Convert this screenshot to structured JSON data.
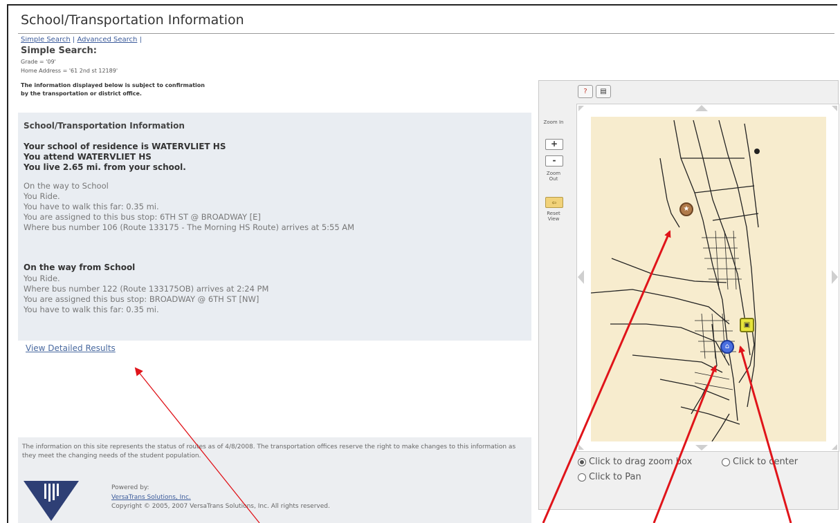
{
  "page": {
    "title": "School/Transportation Information",
    "breadcrumb": {
      "simple": "Simple Search",
      "separator": "|",
      "advanced": "Advanced Search",
      "trailing": "|"
    }
  },
  "search": {
    "heading": "Simple Search:",
    "criteria_grade": "Grade = '09'",
    "criteria_address": "Home Address = '61 2nd st 12189'",
    "disclaimer_line1": "The information displayed below is subject to confirmation",
    "disclaimer_line2": "by the transportation or district office."
  },
  "info": {
    "heading": "School/Transportation Information",
    "residence": "Your school of residence is WATERVLIET HS",
    "attend": "You attend WATERVLIET HS",
    "distance": "You live 2.65 mi. from your school.",
    "to_school": {
      "heading": "On the way to School",
      "mode": "You Ride.",
      "walk": "You have to walk this far: 0.35 mi.",
      "stop": "You are assigned to this bus stop: 6TH ST @ BROADWAY [E]",
      "bus": "Where bus number 106 (Route 133175 - The Morning HS Route) arrives at 5:55 AM"
    },
    "from_school": {
      "heading": "On the way from School",
      "mode": "You Ride.",
      "bus": "Where bus number 122 (Route 133175OB) arrives at 2:24 PM",
      "stop": "You are assigned this bus stop: BROADWAY @ 6TH ST [NW]",
      "walk": "You have to walk this far: 0.35 mi."
    }
  },
  "links": {
    "detailed": "View Detailed Results"
  },
  "footer": {
    "notice": "The information on this site represents the status of routes as of 4/8/2008. The transportation offices reserve the right to make changes to this information as they meet the changing needs of the student population.",
    "powered_by": "Powered by:",
    "vendor": "VersaTrans Solutions, Inc.",
    "copyright": "Copyright © 2005, 2007 VersaTrans Solutions, Inc. All rights reserved."
  },
  "map": {
    "zoom_in_label": "Zoom In",
    "zoom_in_button": "+",
    "zoom_out_button": "-",
    "zoom_out_label": "Zoom Out",
    "reset_label": "Reset View",
    "options": {
      "drag_zoom": "Click to drag zoom box",
      "center": "Click to center",
      "pan": "Click to Pan"
    },
    "selected_option": "drag_zoom",
    "colors": {
      "map_bg": "#f7ecce",
      "arrow": "#e0141a",
      "panel": "#e9edf2"
    }
  }
}
